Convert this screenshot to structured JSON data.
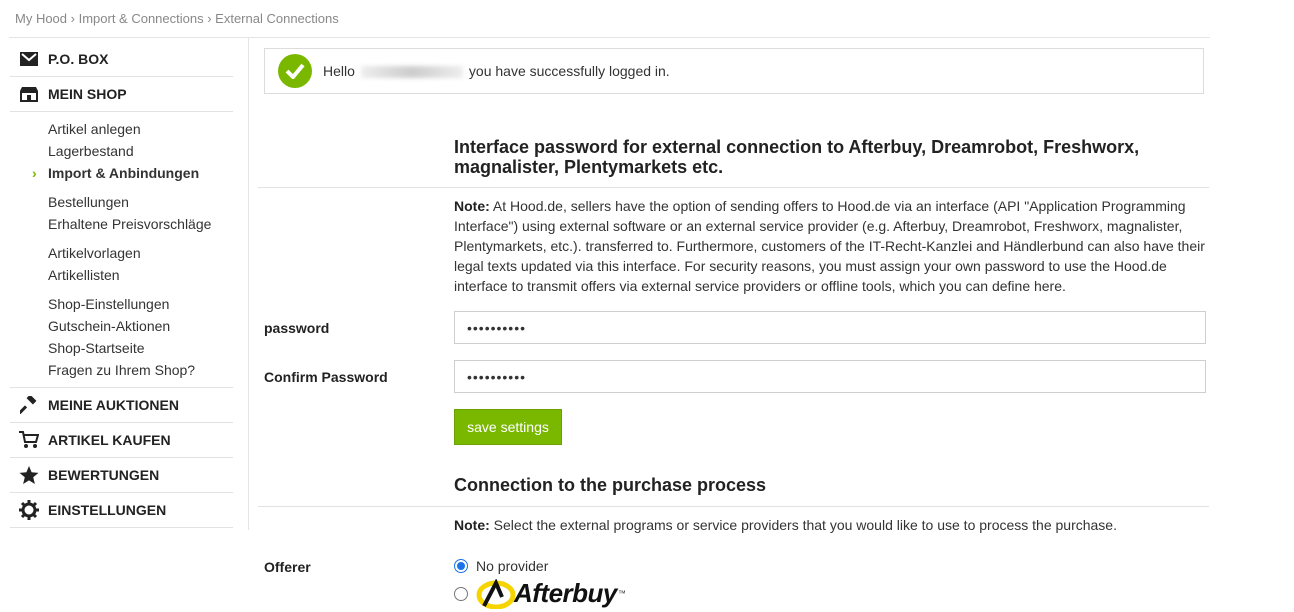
{
  "breadcrumb": {
    "part1": "My Hood",
    "sep": " › ",
    "part2": "Import & Connections",
    "part3": "External Connections"
  },
  "sidebar": {
    "po_box": "P.O. BOX",
    "mein_shop": "MEIN SHOP",
    "shop_items": [
      "Artikel anlegen",
      "Lagerbestand",
      "Import & Anbindungen",
      "Bestellungen",
      "Erhaltene Preisvorschläge",
      "Artikelvorlagen",
      "Artikellisten",
      "Shop-Einstellungen",
      "Gutschein-Aktionen",
      "Shop-Startseite",
      "Fragen zu Ihrem Shop?"
    ],
    "active_marker": "›",
    "meine_auktionen": "MEINE AUKTIONEN",
    "artikel_kaufen": "ARTIKEL KAUFEN",
    "bewertungen": "BEWERTUNGEN",
    "einstellungen": "EINSTELLUNGEN"
  },
  "success": {
    "hello": "Hello",
    "message": "you have successfully logged in."
  },
  "interface": {
    "heading": "Interface password for external connection to Afterbuy, Dreamrobot, Freshworx, magnalister, Plentymarkets etc.",
    "note_label": "Note:",
    "note_text": " At Hood.de, sellers have the option of sending offers to Hood.de via an interface (API \"Application Programming Interface\") using external software or an external service provider (e.g. Afterbuy, Dreamrobot, Freshworx, magnalister, Plentymarkets, etc.). transferred to. Furthermore, customers of the IT-Recht-Kanzlei and Händlerbund can also have their legal texts updated via this interface. For security reasons, you must assign your own password to use the Hood.de interface to transmit offers via external service providers or offline tools, which you can define here.",
    "password_label": "password",
    "password_value": "••••••••••",
    "confirm_label": "Confirm Password",
    "confirm_value": "••••••••••",
    "save_label": "save settings"
  },
  "purchase": {
    "heading": "Connection to the purchase process",
    "note_label": "Note:",
    "note_text": " Select the external programs or service providers that you would like to use to process the purchase.",
    "offerer_label": "Offerer",
    "option_none": "No provider",
    "option_afterbuy": "Afterbuy",
    "tm": "™"
  },
  "colors": {
    "accent": "#7ab800",
    "radio_selected": "#1a73e8"
  }
}
